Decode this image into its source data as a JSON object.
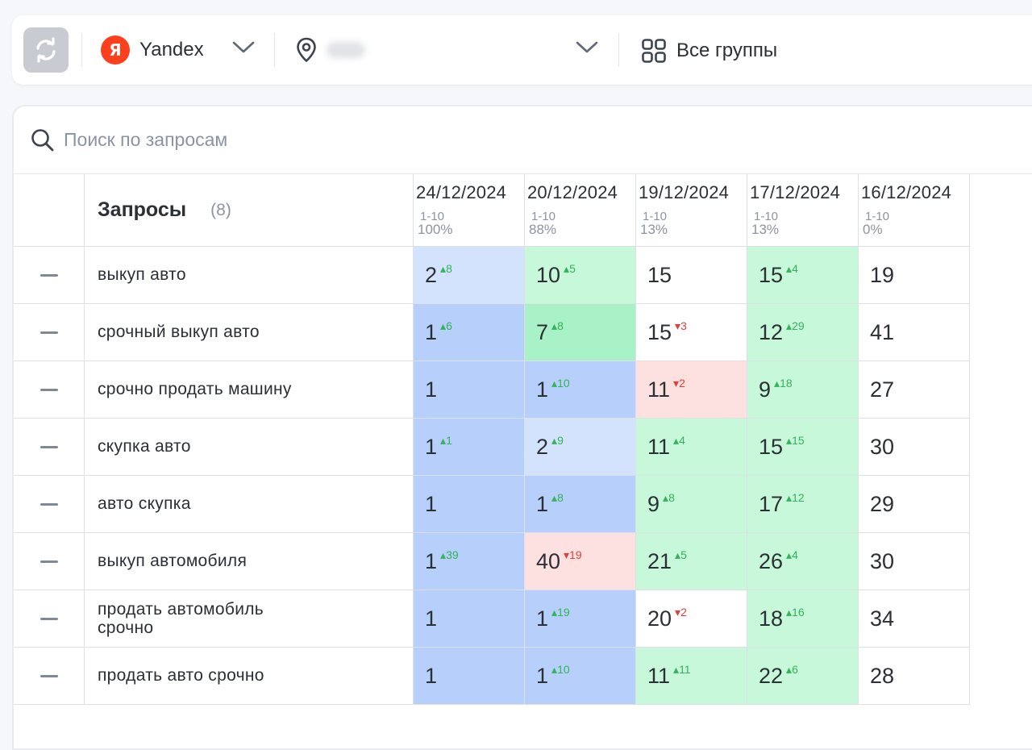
{
  "toolbar": {
    "engine_label": "Yandex",
    "engine_logo_letter": "Я",
    "groups_label": "Все группы"
  },
  "search": {
    "placeholder": "Поиск по запросам"
  },
  "table": {
    "title": "Запросы",
    "count": "(8)",
    "dates": [
      {
        "date": "24/12/2024",
        "range": "1-10",
        "pct": "100%"
      },
      {
        "date": "20/12/2024",
        "range": "1-10",
        "pct": "88%"
      },
      {
        "date": "19/12/2024",
        "range": "1-10",
        "pct": "13%"
      },
      {
        "date": "17/12/2024",
        "range": "1-10",
        "pct": "13%"
      },
      {
        "date": "16/12/2024",
        "range": "1-10",
        "pct": "0%"
      }
    ],
    "rows": [
      {
        "query": "выкуп авто",
        "cells": [
          {
            "v": "2",
            "d": "8",
            "dir": "up",
            "bg": "lblue"
          },
          {
            "v": "10",
            "d": "5",
            "dir": "up",
            "bg": "lgreen"
          },
          {
            "v": "15",
            "d": "",
            "dir": "",
            "bg": "white"
          },
          {
            "v": "15",
            "d": "4",
            "dir": "up",
            "bg": "lgreen"
          },
          {
            "v": "19",
            "d": "",
            "dir": "",
            "bg": "white"
          }
        ]
      },
      {
        "query": "срочный выкуп авто",
        "cells": [
          {
            "v": "1",
            "d": "6",
            "dir": "up",
            "bg": "blue"
          },
          {
            "v": "7",
            "d": "8",
            "dir": "up",
            "bg": "green"
          },
          {
            "v": "15",
            "d": "3",
            "dir": "down",
            "bg": "white"
          },
          {
            "v": "12",
            "d": "29",
            "dir": "up",
            "bg": "lgreen"
          },
          {
            "v": "41",
            "d": "",
            "dir": "",
            "bg": "white"
          }
        ]
      },
      {
        "query": "срочно продать машину",
        "cells": [
          {
            "v": "1",
            "d": "",
            "dir": "",
            "bg": "blue"
          },
          {
            "v": "1",
            "d": "10",
            "dir": "up",
            "bg": "blue"
          },
          {
            "v": "11",
            "d": "2",
            "dir": "down",
            "bg": "red"
          },
          {
            "v": "9",
            "d": "18",
            "dir": "up",
            "bg": "lgreen"
          },
          {
            "v": "27",
            "d": "",
            "dir": "",
            "bg": "white"
          }
        ]
      },
      {
        "query": "скупка авто",
        "cells": [
          {
            "v": "1",
            "d": "1",
            "dir": "up",
            "bg": "blue"
          },
          {
            "v": "2",
            "d": "9",
            "dir": "up",
            "bg": "lblue"
          },
          {
            "v": "11",
            "d": "4",
            "dir": "up",
            "bg": "lgreen"
          },
          {
            "v": "15",
            "d": "15",
            "dir": "up",
            "bg": "lgreen"
          },
          {
            "v": "30",
            "d": "",
            "dir": "",
            "bg": "white"
          }
        ]
      },
      {
        "query": "авто скупка",
        "cells": [
          {
            "v": "1",
            "d": "",
            "dir": "",
            "bg": "blue"
          },
          {
            "v": "1",
            "d": "8",
            "dir": "up",
            "bg": "blue"
          },
          {
            "v": "9",
            "d": "8",
            "dir": "up",
            "bg": "lgreen"
          },
          {
            "v": "17",
            "d": "12",
            "dir": "up",
            "bg": "lgreen"
          },
          {
            "v": "29",
            "d": "",
            "dir": "",
            "bg": "white"
          }
        ]
      },
      {
        "query": "выкуп автомобиля",
        "cells": [
          {
            "v": "1",
            "d": "39",
            "dir": "up",
            "bg": "blue"
          },
          {
            "v": "40",
            "d": "19",
            "dir": "down",
            "bg": "red"
          },
          {
            "v": "21",
            "d": "5",
            "dir": "up",
            "bg": "lgreen"
          },
          {
            "v": "26",
            "d": "4",
            "dir": "up",
            "bg": "lgreen"
          },
          {
            "v": "30",
            "d": "",
            "dir": "",
            "bg": "white"
          }
        ]
      },
      {
        "query": "продать автомобиль срочно",
        "cells": [
          {
            "v": "1",
            "d": "",
            "dir": "",
            "bg": "blue"
          },
          {
            "v": "1",
            "d": "19",
            "dir": "up",
            "bg": "blue"
          },
          {
            "v": "20",
            "d": "2",
            "dir": "down",
            "bg": "white"
          },
          {
            "v": "18",
            "d": "16",
            "dir": "up",
            "bg": "lgreen"
          },
          {
            "v": "34",
            "d": "",
            "dir": "",
            "bg": "white"
          }
        ]
      },
      {
        "query": "продать авто срочно",
        "cells": [
          {
            "v": "1",
            "d": "",
            "dir": "",
            "bg": "blue"
          },
          {
            "v": "1",
            "d": "10",
            "dir": "up",
            "bg": "blue"
          },
          {
            "v": "11",
            "d": "11",
            "dir": "up",
            "bg": "lgreen"
          },
          {
            "v": "22",
            "d": "6",
            "dir": "up",
            "bg": "lgreen"
          },
          {
            "v": "28",
            "d": "",
            "dir": "",
            "bg": "white"
          }
        ]
      }
    ]
  },
  "colors": {
    "blue": "#b6d0fb",
    "lblue": "#d4e3fd",
    "green": "#a9f1c6",
    "lgreen": "#c8f8da",
    "red": "#fde0e0",
    "white": "#ffffff",
    "up": "#33b35a",
    "down": "#e0403a",
    "yandex": "#fc3f1d"
  },
  "icons": {
    "refresh": "refresh-icon",
    "engine": "yandex-logo",
    "dropdown": "chevron-down-icon",
    "location": "location-pin-icon",
    "groups": "grid-icon",
    "search": "search-icon",
    "row_toggle": "minus-icon",
    "delta_up": "triangle-up-icon",
    "delta_down": "triangle-down-icon"
  }
}
